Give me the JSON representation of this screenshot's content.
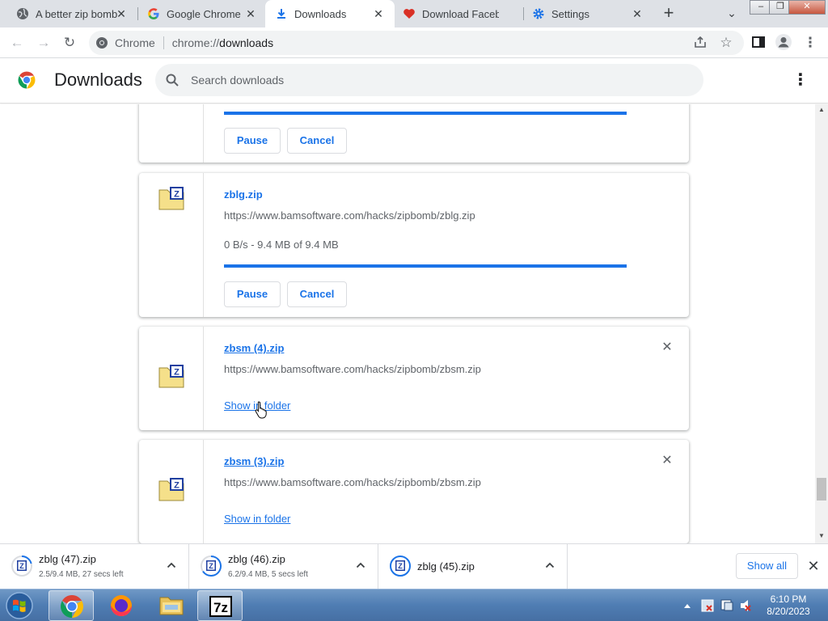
{
  "tabs": [
    {
      "title": "A better zip bomb",
      "icon": "globe-icon"
    },
    {
      "title": "Google Chrome b",
      "icon": "google-icon"
    },
    {
      "title": "Downloads",
      "icon": "download-icon"
    },
    {
      "title": "Download Facebo",
      "icon": "heart-icon"
    },
    {
      "title": "Settings",
      "icon": "gear-icon"
    }
  ],
  "omnibox": {
    "site": "Chrome",
    "url_scheme": "chrome://",
    "url_path": "downloads"
  },
  "header": {
    "title": "Downloads",
    "search_placeholder": "Search downloads"
  },
  "items": [
    {
      "pause": "Pause",
      "cancel": "Cancel"
    },
    {
      "filename": "zblg.zip",
      "url": "https://www.bamsoftware.com/hacks/zipbomb/zblg.zip",
      "status": "0 B/s - 9.4 MB of 9.4 MB",
      "pause": "Pause",
      "cancel": "Cancel"
    },
    {
      "filename": "zbsm (4).zip",
      "url": "https://www.bamsoftware.com/hacks/zipbomb/zbsm.zip",
      "action": "Show in folder"
    },
    {
      "filename": "zbsm (3).zip",
      "url": "https://www.bamsoftware.com/hacks/zipbomb/zbsm.zip",
      "action": "Show in folder"
    }
  ],
  "shelf": {
    "items": [
      {
        "name": "zblg (47).zip",
        "status": "2.5/9.4 MB, 27 secs left"
      },
      {
        "name": "zblg (46).zip",
        "status": "6.2/9.4 MB, 5 secs left"
      },
      {
        "name": "zblg (45).zip",
        "status": ""
      }
    ],
    "show_all": "Show all"
  },
  "taskbar": {
    "time": "6:10 PM",
    "date": "8/20/2023"
  },
  "colors": {
    "accent": "#1a73e8",
    "tabstrip": "#dee1e6",
    "taskbar": "#4f7db3"
  }
}
